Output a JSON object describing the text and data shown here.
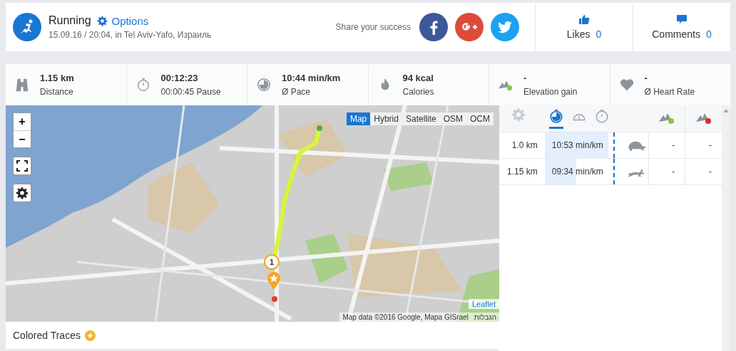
{
  "activity": {
    "title": "Running",
    "options": "Options",
    "subtitle": "15.09.16 / 20:04, in Tel Aviv-Yafo, Израиль"
  },
  "share": {
    "label": "Share your success",
    "networks": [
      {
        "kind": "facebook"
      },
      {
        "kind": "google"
      },
      {
        "kind": "twitter"
      }
    ]
  },
  "social": [
    {
      "kind": "likes",
      "label": "Likes",
      "count": "0"
    },
    {
      "kind": "comments",
      "label": "Comments",
      "count": "0"
    }
  ],
  "stats": [
    {
      "kind": "distance",
      "value": "1.15 km",
      "label": "Distance"
    },
    {
      "kind": "duration",
      "value": "00:12:23",
      "label": "00:00:45 Pause"
    },
    {
      "kind": "pace",
      "value": "10:44 min/km",
      "label": "Ø Pace"
    },
    {
      "kind": "calories",
      "value": "94 kcal",
      "label": "Calories"
    },
    {
      "kind": "elevation",
      "value": "-",
      "label": "Elevation gain"
    },
    {
      "kind": "heart",
      "value": "-",
      "label": "Ø Heart Rate"
    }
  ],
  "map": {
    "zoom_in": "+",
    "zoom_out": "−",
    "layers": [
      {
        "label": "Map",
        "selected": true
      },
      {
        "label": "Hybrid",
        "selected": false
      },
      {
        "label": "Satellite",
        "selected": false
      },
      {
        "label": "OSM",
        "selected": false
      },
      {
        "label": "OCM",
        "selected": false
      }
    ],
    "marker": "1",
    "leaflet": "Leaflet",
    "attribution": "Map data ©2016 Google, Mapa GISrael",
    "terms": "הגבלות"
  },
  "colored_traces": "Colored Traces",
  "splits": {
    "tabs": [
      {
        "kind": "settings",
        "selected": false
      },
      {
        "kind": "pace",
        "selected": true
      },
      {
        "kind": "speed",
        "selected": false
      },
      {
        "kind": "time",
        "selected": false
      }
    ],
    "rows": [
      {
        "distance": "1.0 km",
        "pace": "10:53 min/km",
        "level": 0.8,
        "kind": "slow",
        "up": "-",
        "down": "-"
      },
      {
        "distance": "1.15 km",
        "pace": "09:34 min/km",
        "level": 0.4,
        "kind": "fast",
        "up": "-",
        "down": "-"
      }
    ]
  }
}
